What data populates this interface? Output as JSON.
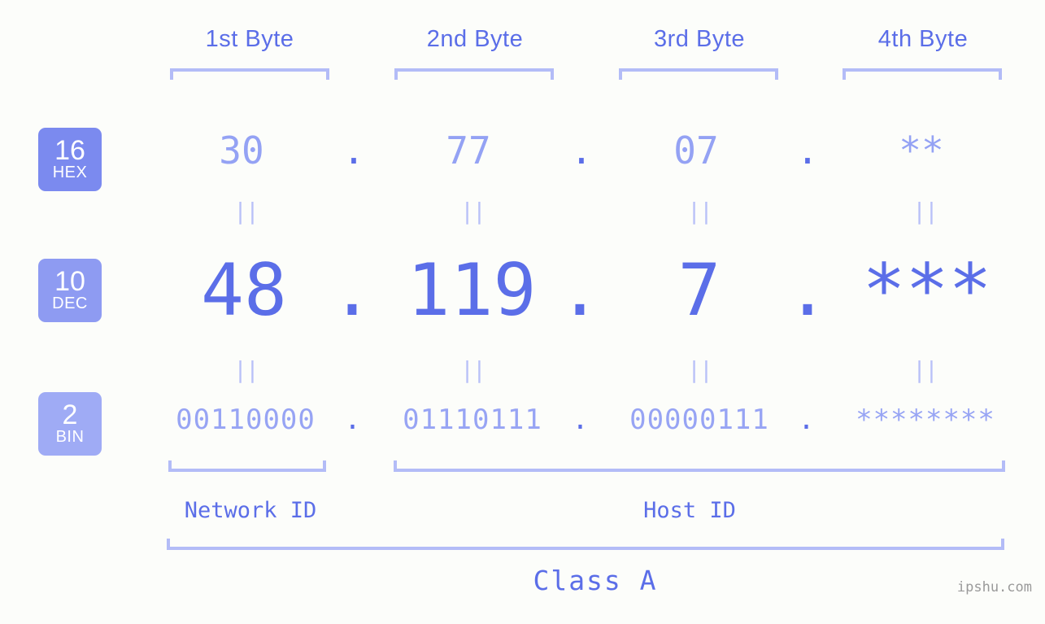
{
  "background_color": "#fcfdfa",
  "accent_color": "#5b6ee8",
  "muted_accent_color": "#94a2f4",
  "bracket_color": "#b3bcf7",
  "header": {
    "bytes": [
      {
        "label": "1st Byte"
      },
      {
        "label": "2nd Byte"
      },
      {
        "label": "3rd Byte"
      },
      {
        "label": "4th Byte"
      }
    ]
  },
  "rows": [
    {
      "base_number": "16",
      "base_name": "HEX",
      "badge_color": "#7b8aef",
      "values": [
        "30",
        "77",
        "07",
        "**"
      ],
      "separators": [
        ".",
        ".",
        "."
      ]
    },
    {
      "base_number": "10",
      "base_name": "DEC",
      "badge_color": "#8e9bf2",
      "values": [
        "48",
        "119",
        "7",
        "***"
      ],
      "separators": [
        ".",
        ".",
        "."
      ]
    },
    {
      "base_number": "2",
      "base_name": "BIN",
      "badge_color": "#9fabf5",
      "values": [
        "00110000",
        "01110111",
        "00000111",
        "********"
      ],
      "separators": [
        ".",
        ".",
        "."
      ]
    }
  ],
  "equals_marks": {
    "glyph": "||",
    "hex_to_dec_count": 4,
    "dec_to_bin_count": 4
  },
  "sections": {
    "network_id": "Network ID",
    "host_id": "Host ID",
    "class": "Class A"
  },
  "watermark": "ipshu.com"
}
